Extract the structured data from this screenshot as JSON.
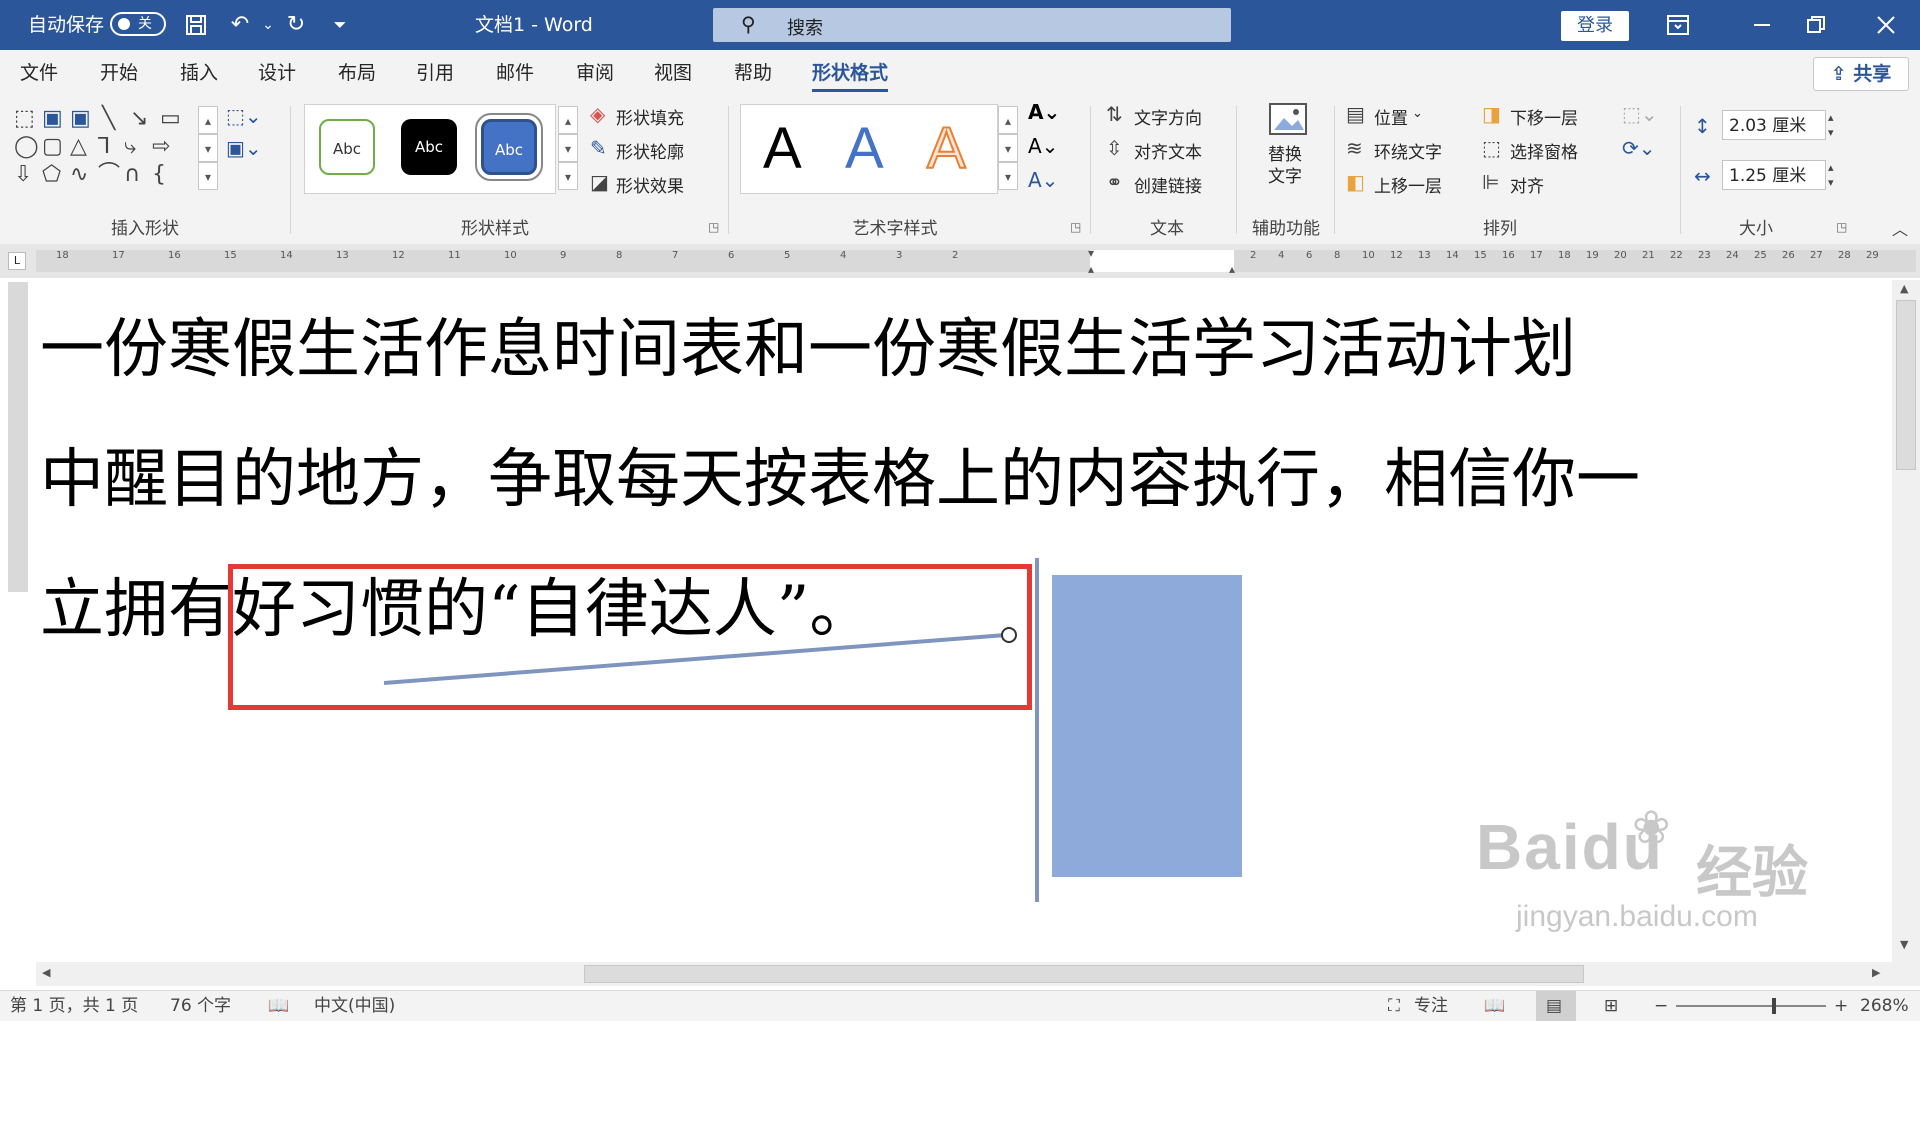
{
  "titlebar": {
    "autosave_label": "自动保存",
    "autosave_state": "关",
    "doc_title": "文档1 - Word",
    "search_placeholder": "搜索",
    "login_label": "登录"
  },
  "tabs": [
    "文件",
    "开始",
    "插入",
    "设计",
    "布局",
    "引用",
    "邮件",
    "审阅",
    "视图",
    "帮助",
    "形状格式"
  ],
  "active_tab": "形状格式",
  "share_label": "共享",
  "ribbon": {
    "groups": {
      "insert_shapes": "插入形状",
      "shape_styles": "形状样式",
      "wordart_styles": "艺术字样式",
      "text": "文本",
      "accessibility": "辅助功能",
      "arrange": "排列",
      "size": "大小"
    },
    "style_sample": "Abc",
    "shape_fill": "形状填充",
    "shape_outline": "形状轮廓",
    "shape_effects": "形状效果",
    "wordart_sample": "A",
    "text_direction": "文字方向",
    "align_text": "对齐文本",
    "create_link": "创建链接",
    "alt_text_line1": "替换",
    "alt_text_line2": "文字",
    "position": "位置",
    "wrap_text": "环绕文字",
    "bring_forward": "上移一层",
    "send_backward": "下移一层",
    "selection_pane": "选择窗格",
    "align": "对齐",
    "height": "2.03 厘米",
    "width": "1.25 厘米"
  },
  "ruler": {
    "left_ticks": [
      "18",
      "17",
      "16",
      "15",
      "14",
      "13",
      "12",
      "11",
      "10",
      "9",
      "8",
      "7",
      "6",
      "5",
      "4",
      "3",
      "2"
    ],
    "right_ticks": [
      "2",
      "4",
      "6",
      "8",
      "10",
      "12",
      "13",
      "14",
      "15",
      "16",
      "17",
      "18",
      "19",
      "20",
      "21",
      "22",
      "23",
      "24",
      "25",
      "26",
      "27",
      "28",
      "29"
    ]
  },
  "document": {
    "lines": [
      "一份寒假生活作息时间表和一份寒假生活学习活动计划",
      "中醒目的地方，争取每天按表格上的内容执行，相信你一",
      "立拥有好习惯的“自律达人”。"
    ],
    "shape_fill": "#8eaadb",
    "highlight_color": "#e53935",
    "line_color": "#7f95c0"
  },
  "status": {
    "page": "第 1 页，共 1 页",
    "words": "76 个字",
    "language": "中文(中国)",
    "focus": "专注",
    "zoom": "268%"
  },
  "watermark": {
    "brand": "Baidu",
    "brand_cn": "经验",
    "url": "jingyan.baidu.com"
  }
}
